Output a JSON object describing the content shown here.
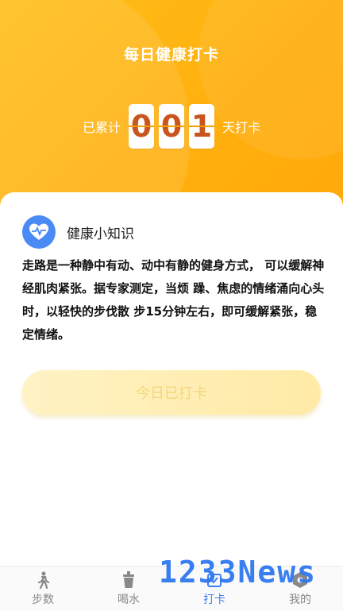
{
  "header": {
    "title": "每日健康打卡",
    "counter_prefix": "已累计",
    "counter_suffix": "天打卡",
    "digits": [
      "0",
      "0",
      "1"
    ]
  },
  "tip": {
    "icon": "heart-pulse-icon",
    "title": "健康小知识",
    "text": "走路是一种静中有动、动中有静的健身方式， 可以缓解神经肌肉紧张。据专家测定，当烦 躁、焦虑的情绪涌向心头时，以轻快的步伐散 步15分钟左右，即可缓解紧张，稳定情绪。"
  },
  "checkin_button": {
    "label": "今日已打卡"
  },
  "tabbar": {
    "items": [
      {
        "label": "步数",
        "icon": "walking-icon"
      },
      {
        "label": "喝水",
        "icon": "cup-icon"
      },
      {
        "label": "打卡",
        "icon": "checkin-icon",
        "active": true
      },
      {
        "label": "我的",
        "icon": "profile-icon"
      }
    ]
  },
  "watermark": {
    "text": "1233News"
  },
  "colors": {
    "hero": "#ffb00f",
    "digit_text": "#c8551e",
    "active_tab": "#3d7ff5",
    "tip_icon_bg": "#4a8af4"
  }
}
